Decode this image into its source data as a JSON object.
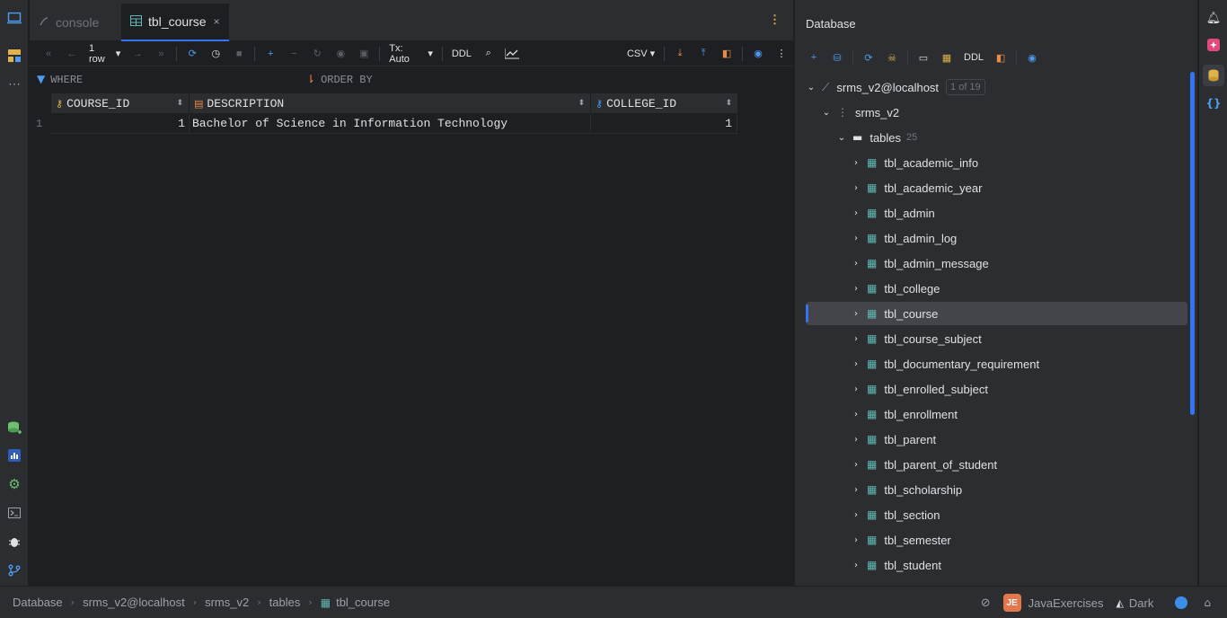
{
  "tabs": [
    {
      "label": "console",
      "active": false
    },
    {
      "label": "tbl_course",
      "active": true,
      "close": "×"
    }
  ],
  "toolbar": {
    "rows_label": "1 row",
    "tx_label": "Tx: Auto",
    "ddl_label": "DDL",
    "csv_label": "CSV"
  },
  "filter": {
    "where_label": "WHERE",
    "orderby_label": "ORDER BY"
  },
  "grid": {
    "columns": [
      "COURSE_ID",
      "DESCRIPTION",
      "COLLEGE_ID"
    ],
    "rows": [
      {
        "num": "1",
        "cells": [
          "1",
          "Bachelor of Science in Information Technology",
          "1"
        ]
      }
    ]
  },
  "db_panel": {
    "title": "Database",
    "ddl_label": "DDL",
    "connection": "srms_v2@localhost",
    "connection_badge": "1 of 19",
    "schema": "srms_v2",
    "tables_label": "tables",
    "tables_count": "25",
    "tables": [
      "tbl_academic_info",
      "tbl_academic_year",
      "tbl_admin",
      "tbl_admin_log",
      "tbl_admin_message",
      "tbl_college",
      "tbl_course",
      "tbl_course_subject",
      "tbl_documentary_requirement",
      "tbl_enrolled_subject",
      "tbl_enrollment",
      "tbl_parent",
      "tbl_parent_of_student",
      "tbl_scholarship",
      "tbl_section",
      "tbl_semester",
      "tbl_student"
    ],
    "selected_table": "tbl_course"
  },
  "statusbar": {
    "breadcrumbs": [
      "Database",
      "srms_v2@localhost",
      "srms_v2",
      "tables",
      "tbl_course"
    ],
    "project_initials": "JE",
    "project_name": "JavaExercises",
    "theme": "Dark"
  },
  "colors": {
    "accent": "#3574f0",
    "background": "#1e1f22",
    "panel": "#2b2d30",
    "table_icon": "#5fb8b2"
  }
}
